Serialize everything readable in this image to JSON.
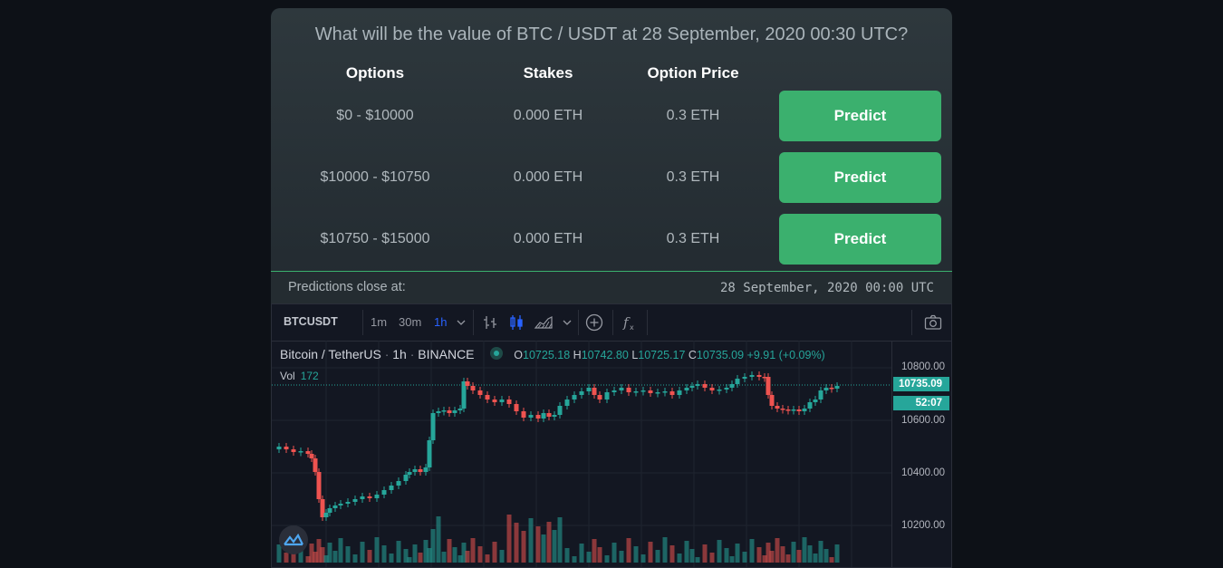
{
  "question": "What will be the value of BTC / USDT at 28 September, 2020 00:30 UTC?",
  "table": {
    "headers": [
      "Options",
      "Stakes",
      "Option Price"
    ],
    "rows": [
      {
        "option": "$0 - $10000",
        "stake": "0.000 ETH",
        "price": "0.3 ETH",
        "button": "Predict"
      },
      {
        "option": "$10000 - $10750",
        "stake": "0.000 ETH",
        "price": "0.3 ETH",
        "button": "Predict"
      },
      {
        "option": "$10750 - $15000",
        "stake": "0.000 ETH",
        "price": "0.3 ETH",
        "button": "Predict"
      }
    ]
  },
  "close": {
    "label": "Predictions close at:",
    "time": "28 September, 2020 00:00 UTC"
  },
  "chart": {
    "symbol": "BTCUSDT",
    "intervals": [
      "1m",
      "30m",
      "1h"
    ],
    "active_interval": "1h",
    "title": "Bitcoin / TetherUS",
    "interval_label": "1h",
    "exchange": "BINANCE",
    "ohlc": {
      "O": "10725.18",
      "H": "10742.80",
      "L": "10725.17",
      "C": "10735.09",
      "change": "+9.91 (+0.09%)"
    },
    "volume_label": "Vol",
    "volume_value": "172",
    "y_ticks": [
      "10800.00",
      "10600.00",
      "10400.00",
      "10200.00"
    ],
    "last_price": "10735.09",
    "countdown": "52:07",
    "colors": {
      "up": "#26a69a",
      "down": "#ef5350",
      "button": "#3bb06e"
    },
    "icons": [
      "chevron-down-icon",
      "bar-style-icon",
      "candle-style-icon",
      "area-style-icon",
      "add-compare-icon",
      "indicators-icon",
      "camera-icon",
      "tradingview-logo-icon"
    ]
  }
}
